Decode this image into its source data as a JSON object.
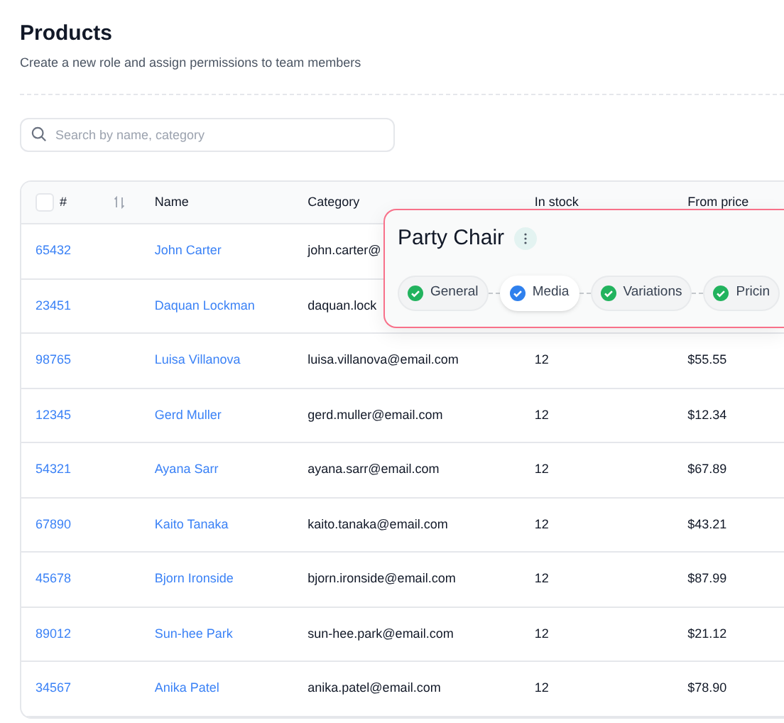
{
  "page": {
    "title": "Products",
    "subtitle": "Create a new role and assign permissions to team members"
  },
  "search": {
    "placeholder": "Search by name, category"
  },
  "table": {
    "select_all_checked": false,
    "columns": [
      "#",
      "Name",
      "Category",
      "In stock",
      "From price"
    ],
    "rows": [
      {
        "id": "65432",
        "name": "John Carter",
        "category": "john.carter@"
      },
      {
        "id": "23451",
        "name": "Daquan Lockman",
        "category": "daquan.lock"
      },
      {
        "id": "98765",
        "name": "Luisa Villanova",
        "category": "luisa.villanova@email.com",
        "stock": "12",
        "price": "$55.55"
      },
      {
        "id": "12345",
        "name": "Gerd Muller",
        "category": "gerd.muller@email.com",
        "stock": "12",
        "price": "$12.34"
      },
      {
        "id": "54321",
        "name": "Ayana Sarr",
        "category": "ayana.sarr@email.com",
        "stock": "12",
        "price": "$67.89"
      },
      {
        "id": "67890",
        "name": "Kaito Tanaka",
        "category": "kaito.tanaka@email.com",
        "stock": "12",
        "price": "$43.21"
      },
      {
        "id": "45678",
        "name": "Bjorn Ironside",
        "category": "bjorn.ironside@email.com",
        "stock": "12",
        "price": "$87.99"
      },
      {
        "id": "89012",
        "name": "Sun-hee Park",
        "category": "sun-hee.park@email.com",
        "stock": "12",
        "price": "$21.12"
      },
      {
        "id": "34567",
        "name": "Anika Patel",
        "category": "anika.patel@email.com",
        "stock": "12",
        "price": "$78.90"
      }
    ]
  },
  "popup": {
    "title": "Party Chair",
    "steps": [
      {
        "label": "General",
        "selected": false
      },
      {
        "label": "Media",
        "selected": true
      },
      {
        "label": "Variations",
        "selected": false
      },
      {
        "label": "Pricin",
        "selected": false
      }
    ]
  }
}
